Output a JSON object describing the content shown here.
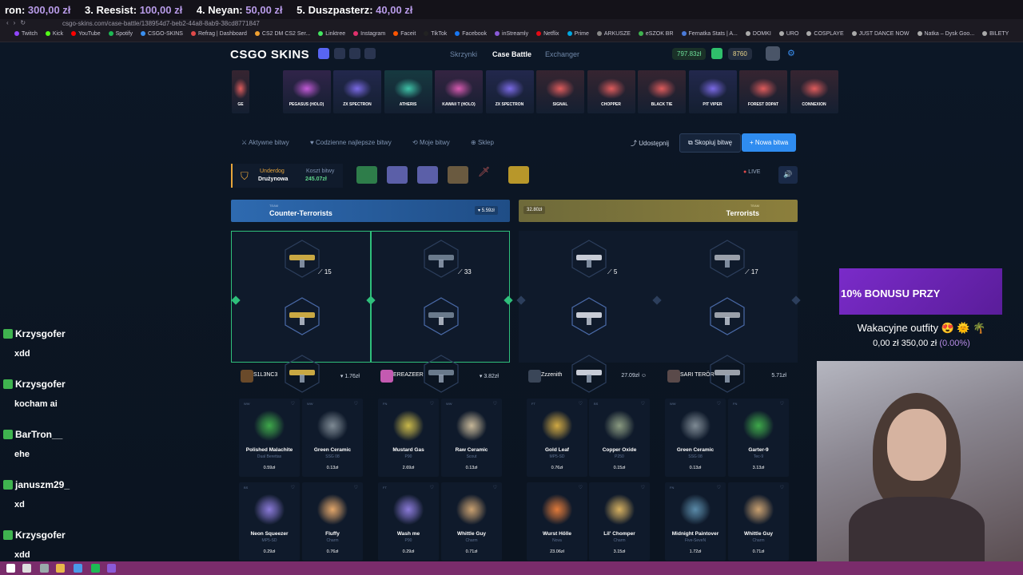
{
  "ticker": {
    "items": [
      {
        "label": "ron:",
        "amount": "300,00 zł"
      },
      {
        "label": "3. Reesist:",
        "amount": "100,00 zł"
      },
      {
        "label": "4. Neyan:",
        "amount": "50,00 zł"
      },
      {
        "label": "5. Duszpasterz:",
        "amount": "40,00 zł"
      }
    ]
  },
  "browser": {
    "url": "csgo-skins.com/case-battle/138954d7-beb2-44a8-8ab9-38cd8771847",
    "bookmarks": [
      "Twitch",
      "Kick",
      "YouTube",
      "Spotify",
      "CSGO-SKINS",
      "Refrag | Dashboard",
      "CS2 DM CS2 Ser...",
      "Linktree",
      "Instagram",
      "Faceit",
      "TikTok",
      "Facebook",
      "inStreamly",
      "Netflix",
      "Prime",
      "ARKUSZE",
      "eSZOK BR",
      "Fernatka Stats | A...",
      "DOMKI",
      "URO",
      "COSPLAYE",
      "JUST DANCE NOW",
      "Natka – Dysk Goo...",
      "BILETY"
    ]
  },
  "site": {
    "logo": "CSGO SKINS",
    "nav": [
      "Skrzynki",
      "Case Battle",
      "Exchanger"
    ],
    "balance": "797.83zł",
    "coins": "8760"
  },
  "feed": [
    {
      "name": "GE",
      "color": "#e05c5c"
    },
    {
      "name": "PEGASUS (HOLO)",
      "color": "#c35ad8"
    },
    {
      "name": "ZX SPECTRON",
      "color": "#7b6ae6"
    },
    {
      "name": "ATHERIS",
      "color": "#3fc3a8"
    },
    {
      "name": "KAWAII T (HOLO)",
      "color": "#d85ab1"
    },
    {
      "name": "ZX SPECTRON",
      "color": "#7b6ae6"
    },
    {
      "name": "SIGNAL",
      "color": "#e05c5c"
    },
    {
      "name": "CHOPPER",
      "color": "#e05c5c"
    },
    {
      "name": "BLACK TIE",
      "color": "#e05c5c"
    },
    {
      "name": "PIT VIPER",
      "color": "#7b6ae6"
    },
    {
      "name": "FOREST DDPAT",
      "color": "#e05c5c"
    },
    {
      "name": "CONNEXION",
      "color": "#e05c5c"
    }
  ],
  "tabs": [
    "Aktywne bitwy",
    "Codzienne najlepsze bitwy",
    "Moje bitwy",
    "Sklep"
  ],
  "actions": {
    "share": "Udostępnij",
    "copy": "Skopiuj bitwę",
    "new": "+ Nowa bitwa"
  },
  "battle": {
    "mode_title": "Underdog",
    "mode_sub": "Drużynowa",
    "cost_label": "Koszt bitwy",
    "cost_value": "245.07zł",
    "live": "LIVE"
  },
  "teams": {
    "ct": {
      "tag": "TEAM",
      "name": "Counter-Terrorists",
      "value": "5.59zł"
    },
    "t": {
      "tag": "TEAM",
      "name": "Terrorists",
      "value": "32.80zł"
    }
  },
  "multipliers": [
    "15",
    "33",
    "5",
    "17"
  ],
  "players": [
    {
      "name": "S1L3NC3",
      "value": "1.76zł"
    },
    {
      "name": "EREAZEER",
      "value": "3.82zł"
    },
    {
      "name": "Zzzenith",
      "value": "27.09zł"
    },
    {
      "name": "SARI TERÖR",
      "value": "5.71zł"
    }
  ],
  "items_row1": [
    {
      "cond": "WW",
      "name": "Polished Malachite",
      "sub": "Dual Berettas",
      "price": "0.59zł",
      "color": "#3ea84a"
    },
    {
      "cond": "WW",
      "name": "Green Ceramic",
      "sub": "SSG 08",
      "price": "0.13zł",
      "color": "#7e8a94"
    },
    {
      "cond": "FN",
      "name": "Mustard Gas",
      "sub": "P90",
      "price": "2.69zł",
      "color": "#c9b84a"
    },
    {
      "cond": "WW",
      "name": "Raw Ceramic",
      "sub": "Scout",
      "price": "0.13zł",
      "color": "#c6b798"
    },
    {
      "cond": "FT",
      "name": "Gold Leaf",
      "sub": "MP5-SD",
      "price": "0.76zł",
      "color": "#cfa843"
    },
    {
      "cond": "BS",
      "name": "Copper Oxide",
      "sub": "P250",
      "price": "0.15zł",
      "color": "#8a9a80"
    },
    {
      "cond": "WW",
      "name": "Green Ceramic",
      "sub": "SSG 08",
      "price": "0.13zł",
      "color": "#7e8a94"
    },
    {
      "cond": "FN",
      "name": "Garter-9",
      "sub": "Tec-9",
      "price": "3.13zł",
      "color": "#3ea84a"
    }
  ],
  "items_row2": [
    {
      "cond": "BS",
      "name": "Neon Squeezer",
      "sub": "MP5-SD",
      "price": "0.29zł",
      "color": "#8a7ad8"
    },
    {
      "cond": "",
      "name": "Fluffy",
      "sub": "Charm",
      "price": "0.76zł",
      "color": "#e2a66a"
    },
    {
      "cond": "FT",
      "name": "Wash me",
      "sub": "P90",
      "price": "0.29zł",
      "color": "#8a7ad8"
    },
    {
      "cond": "",
      "name": "Whittle Guy",
      "sub": "Charm",
      "price": "0.71zł",
      "color": "#c9a070"
    },
    {
      "cond": "",
      "name": "Wurst Hölle",
      "sub": "Nova",
      "price": "23.06zł",
      "color": "#e07a3a"
    },
    {
      "cond": "",
      "name": "Lil' Chomper",
      "sub": "Charm",
      "price": "3.15zł",
      "color": "#d6b060"
    },
    {
      "cond": "FN",
      "name": "Midnight Paintover",
      "sub": "Five-SeveN",
      "price": "1.72zł",
      "color": "#5a8aa8"
    },
    {
      "cond": "",
      "name": "Whittle Guy",
      "sub": "Charm",
      "price": "0.71zł",
      "color": "#c9a070"
    }
  ],
  "promo": {
    "text": "10% BONUSU PRZY"
  },
  "goal": {
    "title": "Wakacyjne outfity 😍 🌞 🌴",
    "progress": "0,00 zł  350,00 zł",
    "pct": "(0.00%)"
  },
  "chat": [
    {
      "user": "Krzysgofer",
      "msg": "xdd",
      "color": "#a8d25a"
    },
    {
      "user": "Krzysgofer",
      "msg": "kocham ai",
      "color": "#a8d25a"
    },
    {
      "user": "BarTron__",
      "msg": "ehe",
      "color": "#7aa6ff"
    },
    {
      "user": "januszm29_",
      "msg": "xd",
      "color": "#e26bb1"
    },
    {
      "user": "Krzysgofer",
      "msg": "xdd",
      "color": "#a8d25a"
    }
  ]
}
